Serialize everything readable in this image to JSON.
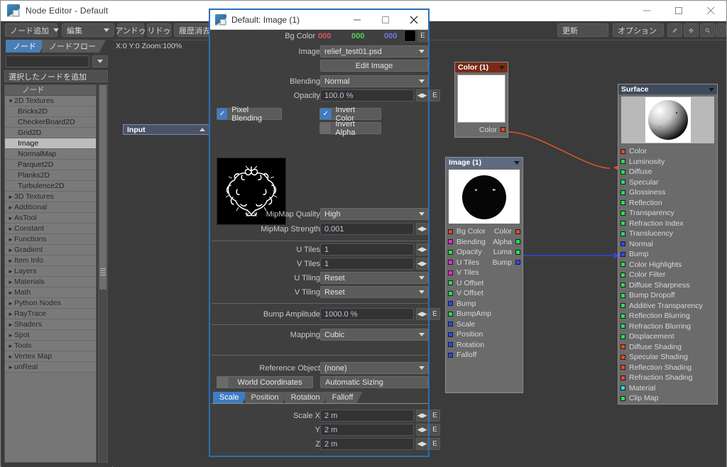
{
  "window": {
    "title": "Node Editor - Default",
    "minimize": "−",
    "maximize": "□",
    "close": "✕"
  },
  "toolbar": {
    "add_node": "ノード追加",
    "edit": "編集",
    "undo": "アンドゥ",
    "redo": "リドゥ",
    "clear_history": "履歴消去",
    "update": "更新",
    "options": "オプション",
    "pen_icon": "pen-icon",
    "move_icon": "move-icon",
    "zoom_icon": "magnifier-icon",
    "play_icon": "play-icon"
  },
  "sidebar": {
    "tabs": [
      {
        "label": "ノード",
        "selected": true
      },
      {
        "label": "ノードフロー",
        "selected": false
      }
    ],
    "search_value": "",
    "add_selected": "選択したノードを追加",
    "tree_title": "ノード",
    "tree": [
      {
        "label": "2D Textures",
        "type": "group",
        "expanded": true
      },
      {
        "label": "Bricks2D",
        "type": "child"
      },
      {
        "label": "CheckerBoard2D",
        "type": "child"
      },
      {
        "label": "Grid2D",
        "type": "child"
      },
      {
        "label": "Image",
        "type": "child",
        "selected": true
      },
      {
        "label": "NormalMap",
        "type": "child"
      },
      {
        "label": "Parquet2D",
        "type": "child"
      },
      {
        "label": "Planks2D",
        "type": "child"
      },
      {
        "label": "Turbulence2D",
        "type": "child"
      },
      {
        "label": "3D Textures",
        "type": "group",
        "expanded": false
      },
      {
        "label": "Additional",
        "type": "group",
        "expanded": false
      },
      {
        "label": "AsTool",
        "type": "group",
        "expanded": false
      },
      {
        "label": "Constant",
        "type": "group",
        "expanded": false
      },
      {
        "label": "Functions",
        "type": "group",
        "expanded": false
      },
      {
        "label": "Gradient",
        "type": "group",
        "expanded": false
      },
      {
        "label": "Item Info",
        "type": "group",
        "expanded": false
      },
      {
        "label": "Layers",
        "type": "group",
        "expanded": false
      },
      {
        "label": "Materials",
        "type": "group",
        "expanded": false
      },
      {
        "label": "Math",
        "type": "group",
        "expanded": false
      },
      {
        "label": "Python Nodes",
        "type": "group",
        "expanded": false
      },
      {
        "label": "RayTrace",
        "type": "group",
        "expanded": false
      },
      {
        "label": "Shaders",
        "type": "group",
        "expanded": false
      },
      {
        "label": "Spot",
        "type": "group",
        "expanded": false
      },
      {
        "label": "Tools",
        "type": "group",
        "expanded": false
      },
      {
        "label": "Vertex Map",
        "type": "group",
        "expanded": false
      },
      {
        "label": "unReal",
        "type": "group",
        "expanded": false
      }
    ]
  },
  "canvas": {
    "coords": "X:0  Y:0  Zoom:100%",
    "input_node": "Input",
    "nodes": {
      "color": {
        "title": "Color (1)",
        "header_color": "#7a2a16",
        "output_label": "Color"
      },
      "image": {
        "title": "Image (1)",
        "header_color": "#5c6a82",
        "inputs": [
          {
            "label": "Bg Color",
            "color": "red"
          },
          {
            "label": "Blending",
            "color": "magenta"
          },
          {
            "label": "Opacity",
            "color": "green"
          },
          {
            "label": "U Tiles",
            "color": "magenta"
          },
          {
            "label": "V Tiles",
            "color": "magenta"
          },
          {
            "label": "U Offset",
            "color": "green"
          },
          {
            "label": "V Offset",
            "color": "green"
          },
          {
            "label": "Bump",
            "color": "blue"
          },
          {
            "label": "BumpAmp",
            "color": "green"
          },
          {
            "label": "Scale",
            "color": "blue"
          },
          {
            "label": "Position",
            "color": "blue"
          },
          {
            "label": "Rotation",
            "color": "blue"
          },
          {
            "label": "Falloff",
            "color": "blue"
          }
        ],
        "outputs": [
          {
            "label": "Color",
            "color": "red"
          },
          {
            "label": "Alpha",
            "color": "green"
          },
          {
            "label": "Luma",
            "color": "green"
          },
          {
            "label": "Bump",
            "color": "blue"
          }
        ]
      },
      "surface": {
        "title": "Surface",
        "header_color": "#3f4a5e",
        "inputs": [
          {
            "label": "Color",
            "color": "red"
          },
          {
            "label": "Luminosity",
            "color": "green"
          },
          {
            "label": "Diffuse",
            "color": "green"
          },
          {
            "label": "Specular",
            "color": "green"
          },
          {
            "label": "Glossiness",
            "color": "green"
          },
          {
            "label": "Reflection",
            "color": "green"
          },
          {
            "label": "Transparency",
            "color": "green"
          },
          {
            "label": "Refraction Index",
            "color": "green"
          },
          {
            "label": "Translucency",
            "color": "green"
          },
          {
            "label": "Normal",
            "color": "blue"
          },
          {
            "label": "Bump",
            "color": "blue"
          },
          {
            "label": "Color Highlights",
            "color": "green"
          },
          {
            "label": "Color Filter",
            "color": "green"
          },
          {
            "label": "Diffuse Sharpness",
            "color": "green"
          },
          {
            "label": "Bump Dropoff",
            "color": "green"
          },
          {
            "label": "Additive Transparency",
            "color": "green"
          },
          {
            "label": "Reflection Blurring",
            "color": "green"
          },
          {
            "label": "Refraction Blurring",
            "color": "green"
          },
          {
            "label": "Displacement",
            "color": "green"
          },
          {
            "label": "Diffuse Shading",
            "color": "red"
          },
          {
            "label": "Specular Shading",
            "color": "red"
          },
          {
            "label": "Reflection Shading",
            "color": "red"
          },
          {
            "label": "Refraction Shading",
            "color": "red"
          },
          {
            "label": "Material",
            "color": "cyan"
          },
          {
            "label": "Clip Map",
            "color": "green"
          }
        ]
      }
    },
    "wires": [
      {
        "from": "color.Color",
        "to": "surface.Color",
        "color": "#e0522a"
      },
      {
        "from": "image.Bump",
        "to": "surface.Bump",
        "color": "#2b48f0"
      }
    ]
  },
  "dialog": {
    "title": "Default: Image (1)",
    "minimize": "−",
    "maximize": "□",
    "close": "✕",
    "bg_color": {
      "label": "Bg Color",
      "r": "000",
      "g": "000",
      "b": "000",
      "r_color": "#d05a5a",
      "g_color": "#5ad05a",
      "b_color": "#6a7ce8",
      "swatch": "#000000",
      "e": "E"
    },
    "image": {
      "label": "Image",
      "value": "relief_test01.psd"
    },
    "edit_image": "Edit Image",
    "blending": {
      "label": "Blending",
      "value": "Normal"
    },
    "opacity": {
      "label": "Opacity",
      "value": "100.0 %",
      "e": "E"
    },
    "pixel_blending": {
      "label": "Pixel Blending",
      "checked": true
    },
    "invert_color": {
      "label": "Invert Color",
      "checked": true
    },
    "invert_alpha": {
      "label": "Invert Alpha",
      "checked": false
    },
    "mipmap_quality": {
      "label": "MipMap Quality",
      "value": "High"
    },
    "mipmap_strength": {
      "label": "MipMap Strength",
      "value": "0.001"
    },
    "u_tiles": {
      "label": "U Tiles",
      "value": "1"
    },
    "v_tiles": {
      "label": "V Tiles",
      "value": "1"
    },
    "u_tiling": {
      "label": "U Tiling",
      "value": "Reset"
    },
    "v_tiling": {
      "label": "V Tiling",
      "value": "Reset"
    },
    "bump_amplitude": {
      "label": "Bump Amplitude",
      "value": "1000.0 %",
      "e": "E"
    },
    "mapping": {
      "label": "Mapping",
      "value": "Cubic"
    },
    "reference_object": {
      "label": "Reference Object",
      "value": "(none)"
    },
    "world_coordinates": "World Coordinates",
    "automatic_sizing": "Automatic Sizing",
    "transform_tabs": [
      {
        "label": "Scale",
        "selected": true
      },
      {
        "label": "Position",
        "selected": false
      },
      {
        "label": "Rotation",
        "selected": false
      },
      {
        "label": "Falloff",
        "selected": false
      }
    ],
    "scale_x": {
      "label": "Scale X",
      "value": "2 m",
      "e": "E"
    },
    "scale_y": {
      "label": "Y",
      "value": "2 m",
      "e": "E"
    },
    "scale_z": {
      "label": "Z",
      "value": "2 m",
      "e": "E"
    }
  }
}
